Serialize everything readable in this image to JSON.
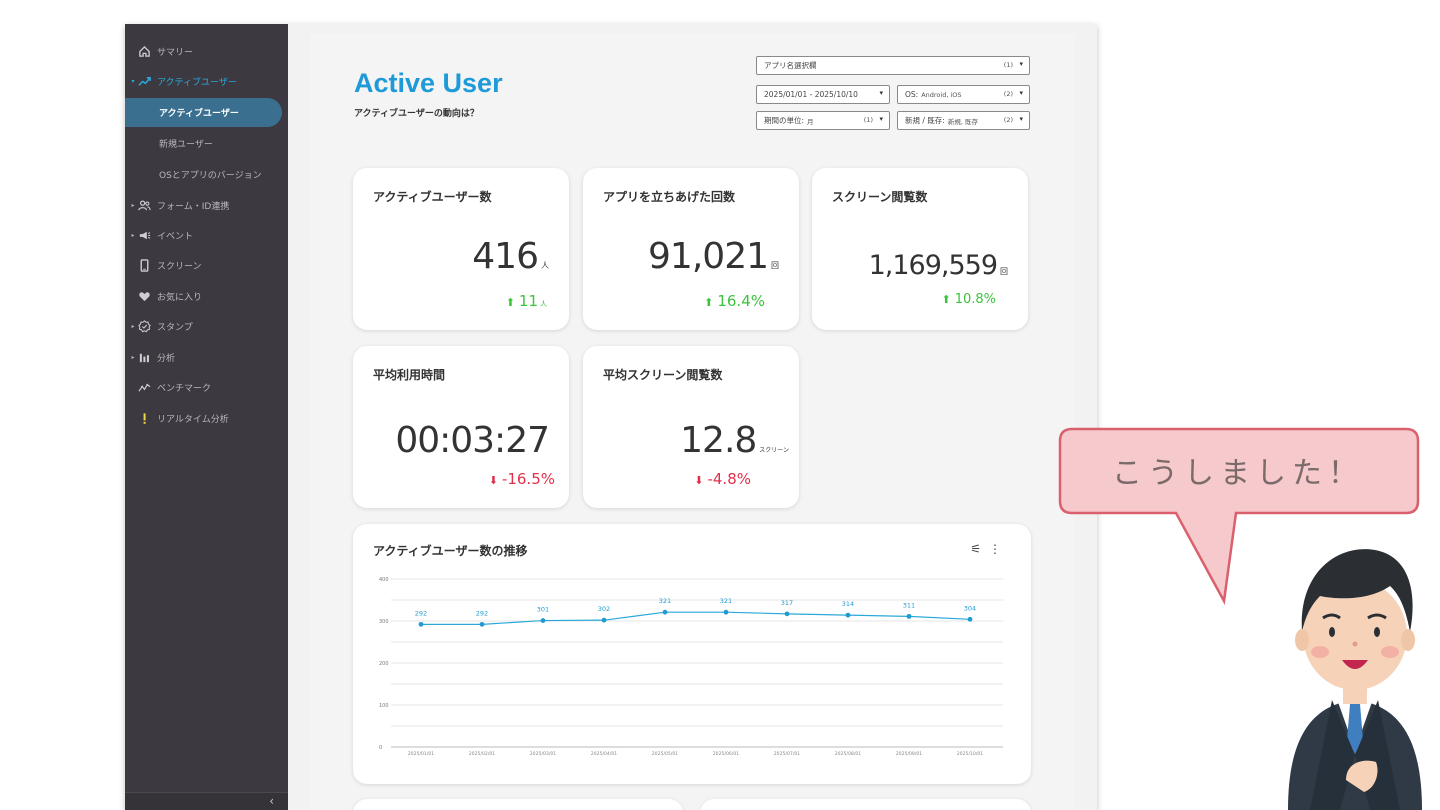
{
  "sidebar": {
    "items": [
      {
        "label": "サマリー",
        "icon": "home-icon"
      },
      {
        "label": "アクティブユーザー",
        "icon": "trending-up-icon"
      },
      {
        "label": "アクティブユーザー"
      },
      {
        "label": "新規ユーザー"
      },
      {
        "label": "OSとアプリのバージョン"
      },
      {
        "label": "フォーム・ID連携",
        "icon": "users-icon"
      },
      {
        "label": "イベント",
        "icon": "megaphone-icon"
      },
      {
        "label": "スクリーン",
        "icon": "phone-icon"
      },
      {
        "label": "お気に入り",
        "icon": "heart-icon"
      },
      {
        "label": "スタンプ",
        "icon": "badge-check-icon"
      },
      {
        "label": "分析",
        "icon": "bar-chart-icon"
      },
      {
        "label": "ベンチマーク",
        "icon": "chart-line-icon"
      },
      {
        "label": "リアルタイム分析",
        "icon": "exclamation-icon"
      }
    ],
    "collapse": "‹"
  },
  "header": {
    "title": "Active User",
    "subtitle": "アクティブユーザーの動向は？"
  },
  "filters": {
    "app": {
      "label": "アプリ名選択欄",
      "count": "(1)"
    },
    "date": {
      "label": "2025/01/01 - 2025/10/10"
    },
    "os": {
      "label": "OS:",
      "value": "Android, iOS",
      "count": "(2)"
    },
    "period": {
      "label": "期間の単位:",
      "value": "月",
      "count": "(1)"
    },
    "newold": {
      "label": "新規 / 既存:",
      "value": "新規, 既存",
      "count": "(2)"
    }
  },
  "kpis": {
    "active_users": {
      "title": "アクティブユーザー数",
      "value": "416",
      "unit": "人",
      "delta": "11",
      "delta_unit": "人"
    },
    "app_launches": {
      "title": "アプリを立ちあげた回数",
      "value": "91,021",
      "unit": "回",
      "delta": "16.4%"
    },
    "screen_views": {
      "title": "スクリーン閲覧数",
      "value": "1,169,559",
      "unit": "回",
      "delta": "10.8%"
    },
    "avg_time": {
      "title": "平均利用時間",
      "value": "00:03:27",
      "delta": "-16.5%"
    },
    "avg_screens": {
      "title": "平均スクリーン閲覧数",
      "value": "12.8",
      "unit": "スクリーン",
      "delta": "-4.8%"
    }
  },
  "colors": {
    "accent": "#1e9ad8",
    "up": "#3cc43c",
    "down": "#e2304a",
    "line": "#2aa9d9",
    "sidebar": "#3c3a40"
  },
  "chart_card": {
    "title": "アクティブユーザー数の推移"
  },
  "chart_data": {
    "type": "line",
    "title": "アクティブユーザー数の推移",
    "x": [
      "2025/01/01",
      "2025/02/01",
      "2025/03/01",
      "2025/04/01",
      "2025/05/01",
      "2025/06/01",
      "2025/07/01",
      "2025/08/01",
      "2025/09/01",
      "2025/10/01"
    ],
    "series": [
      {
        "values": [
          292,
          292,
          301,
          302,
          321,
          321,
          317,
          314,
          311,
          304
        ]
      }
    ],
    "ylim": [
      0,
      400
    ],
    "yticks": [
      0,
      100,
      200,
      300,
      400
    ],
    "grid": true
  },
  "callout": {
    "text": "こうしました！"
  }
}
